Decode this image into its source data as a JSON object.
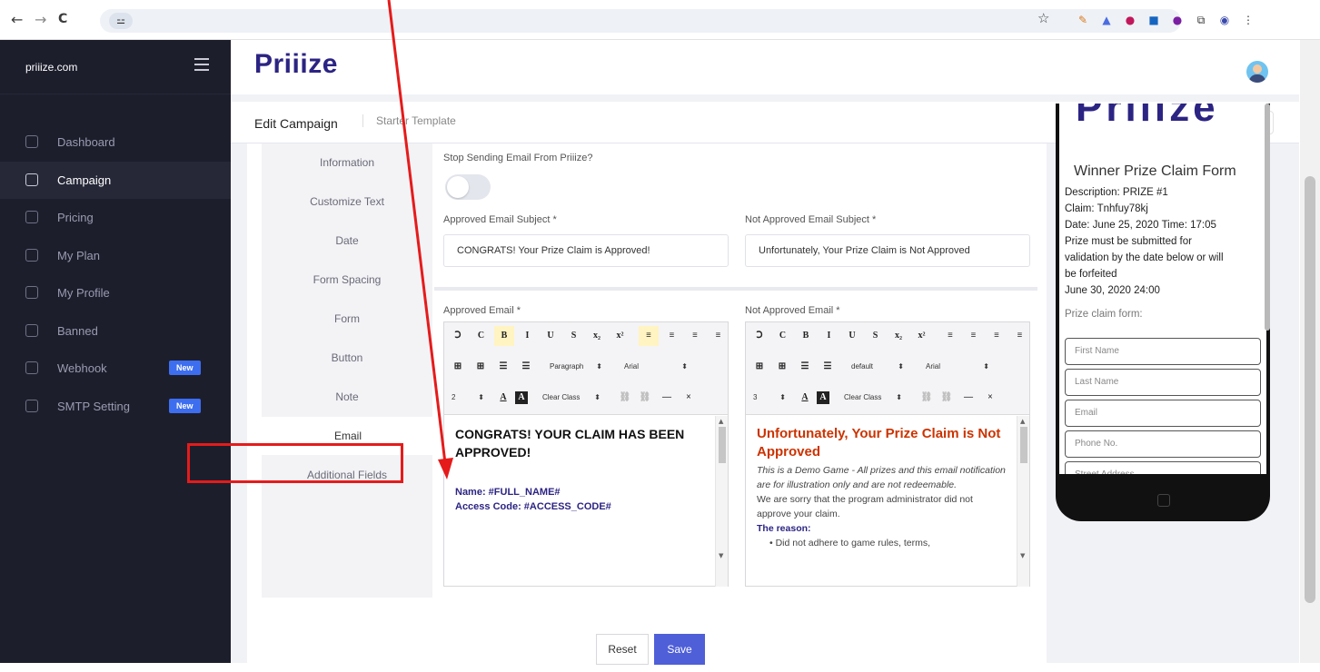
{
  "browser": {
    "back_icon": "←",
    "forward_icon": "→",
    "reload_icon": "C",
    "site_info_icon": "⚍",
    "star_icon": "☆",
    "extensions": [
      {
        "name": "pen-icon",
        "glyph": "✎",
        "color": "#d97a1c"
      },
      {
        "name": "chart-icon",
        "glyph": "▲",
        "color": "#4a6de0"
      },
      {
        "name": "circle-icon",
        "glyph": "●",
        "color": "#c2185b"
      },
      {
        "name": "square-icon",
        "glyph": "■",
        "color": "#1565c0"
      },
      {
        "name": "dot-icon",
        "glyph": "●",
        "color": "#7b1fa2"
      },
      {
        "name": "puzzle-icon",
        "glyph": "⧉",
        "color": "#333333"
      },
      {
        "name": "profile-icon",
        "glyph": "◉",
        "color": "#3949ab"
      },
      {
        "name": "menu-icon",
        "glyph": "⋮",
        "color": "#333333"
      }
    ]
  },
  "sidebar": {
    "brand": "priiize.com",
    "items": [
      {
        "label": "Dashboard",
        "badge": ""
      },
      {
        "label": "Campaign",
        "badge": ""
      },
      {
        "label": "Pricing",
        "badge": ""
      },
      {
        "label": "My Plan",
        "badge": ""
      },
      {
        "label": "My Profile",
        "badge": ""
      },
      {
        "label": "Banned",
        "badge": ""
      },
      {
        "label": "Webhook",
        "badge": "New"
      },
      {
        "label": "SMTP Setting",
        "badge": "New"
      }
    ]
  },
  "header": {
    "logo": "Priiize",
    "title": "Edit Campaign",
    "breadcrumb": "Starter Template",
    "refresh_icon": "↻"
  },
  "tabs": [
    "Information",
    "Customize Text",
    "Date",
    "Form Spacing",
    "Form",
    "Button",
    "Note",
    "Email",
    "Additional Fields"
  ],
  "email_settings": {
    "stop_label": "Stop Sending Email From Priiize?",
    "approved_subject_label": "Approved Email Subject *",
    "approved_subject_value": "CONGRATS! Your Prize Claim is Approved!",
    "not_approved_subject_label": "Not Approved Email Subject *",
    "not_approved_subject_value": "Unfortunately, Your Prize Claim is Not Approved",
    "approved_email_label": "Approved Email *",
    "not_approved_email_label": "Not Approved Email *"
  },
  "editor_toolbar": {
    "row1": [
      "Ↄ",
      "C",
      "B",
      "I",
      "U",
      "S",
      "x₂",
      "x²",
      "≡",
      "≡",
      "≡",
      "≡"
    ],
    "row2_left": [
      "⊞",
      "⊞",
      "☰",
      "☰"
    ],
    "approved": {
      "format": "Paragraph",
      "font": "Arial",
      "size": "2",
      "clear": "Clear Class"
    },
    "not_approved": {
      "format": "default",
      "font": "Arial",
      "size": "3",
      "clear": "Clear Class"
    },
    "color_a": "A",
    "bg_a": "A",
    "link_icon": "⛓",
    "unlink_icon": "⛓",
    "hr_icon": "—",
    "remove_icon": "×"
  },
  "approved_body": {
    "heading": "CONGRATS! YOUR CLAIM HAS BEEN APPROVED!",
    "name_line": "Name: #FULL_NAME#",
    "code_line": "Access Code: #ACCESS_CODE#"
  },
  "not_approved_body": {
    "heading": "Unfortunately, Your Prize Claim is Not Approved",
    "demo_note": "This is a Demo Game - All prizes and this email notification are for illustration only and are not redeemable.",
    "sorry": "We are sorry that the program administrator did not approve your claim.",
    "reason_label": "The reason:",
    "reason_item": "Did not adhere to game rules, terms,"
  },
  "buttons": {
    "reset": "Reset",
    "save": "Save"
  },
  "preview": {
    "logo": "Priiize",
    "title": "Winner Prize Claim Form",
    "description": "Description: PRIZE #1",
    "claim": "Claim: Tnhfuy78kj",
    "date": "Date: June 25, 2020 Time: 17:05",
    "notice_1": "Prize must be submitted for",
    "notice_2": "validation by the date below or will",
    "notice_3": "be forfeited",
    "deadline": "June 30, 2020 24:00",
    "form_label": "Prize claim form:",
    "fields": [
      "First Name",
      "Last Name",
      "Email",
      "Phone No.",
      "Street Address"
    ]
  },
  "colors": {
    "sidebar_bg": "#1d1e2c",
    "brand_purple": "#2c2483",
    "save_button": "#4f5fd8",
    "badge": "#3d6ef0",
    "highlight_red": "#e51b1b",
    "not_approved_heading": "#cc3300"
  }
}
